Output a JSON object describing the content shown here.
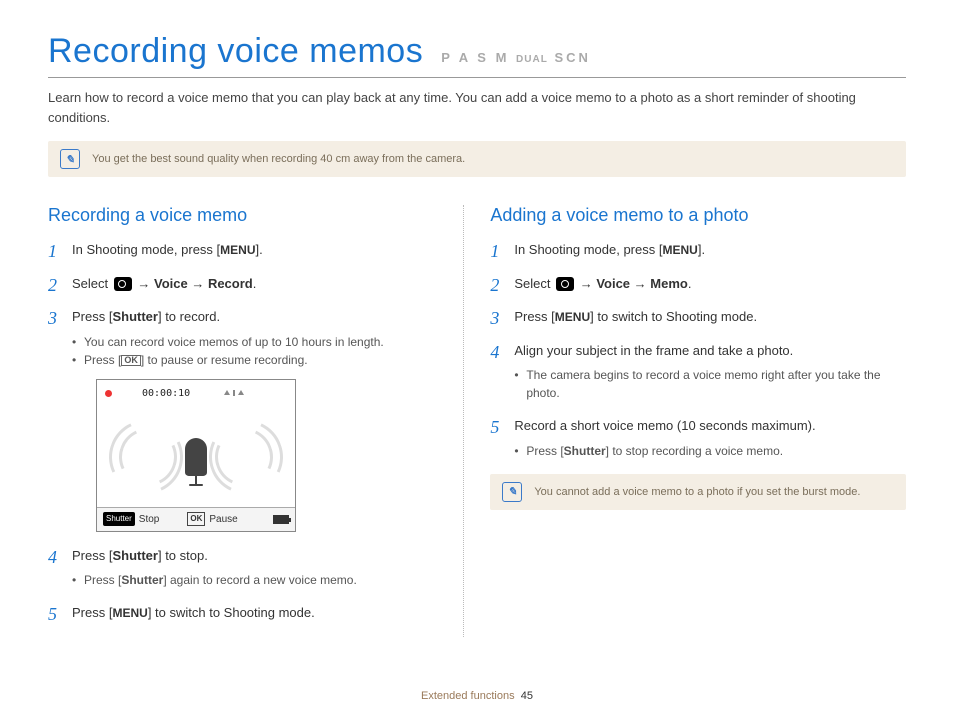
{
  "header": {
    "title": "Recording voice memos",
    "modes": "P A S M",
    "modes_small": "DUAL",
    "modes_end": "SCN"
  },
  "intro": "Learn how to record a voice memo that you can play back at any time. You can add a voice memo to a photo as a short reminder of shooting conditions.",
  "tip_top": "You get the best sound quality when recording 40 cm away from the camera.",
  "left": {
    "heading": "Recording a voice memo",
    "s1_a": "In Shooting mode, press [",
    "s1_menu": "MENU",
    "s1_b": "].",
    "s2_a": "Select ",
    "s2_b": " → ",
    "s2_voice": "Voice",
    "s2_c": " → ",
    "s2_record": "Record",
    "s2_d": ".",
    "s3_a": "Press [",
    "s3_shutter": "Shutter",
    "s3_b": "] to record.",
    "s3_sub1": "You can record voice memos of up to 10 hours in length.",
    "s3_sub2_a": "Press [",
    "s3_sub2_b": "] to pause or resume recording.",
    "s4_a": "Press [",
    "s4_shutter": "Shutter",
    "s4_b": "] to stop.",
    "s4_sub_a": "Press [",
    "s4_sub_shutter": "Shutter",
    "s4_sub_b": "] again to record a new voice memo.",
    "s5_a": "Press [",
    "s5_menu": "MENU",
    "s5_b": "] to switch to Shooting mode.",
    "mock": {
      "time": "00:00:10",
      "stop": "Stop",
      "pause": "Pause",
      "shutter": "Shutter",
      "ok": "OK"
    }
  },
  "right": {
    "heading": "Adding a voice memo to a photo",
    "s1_a": "In Shooting mode, press [",
    "s1_menu": "MENU",
    "s1_b": "].",
    "s2_a": "Select ",
    "s2_b": " → ",
    "s2_voice": "Voice",
    "s2_c": " → ",
    "s2_memo": "Memo",
    "s2_d": ".",
    "s3_a": "Press [",
    "s3_menu": "MENU",
    "s3_b": "] to switch to Shooting mode.",
    "s4": "Align your subject in the frame and take a photo.",
    "s4_sub": "The camera begins to record a voice memo right after you take the photo.",
    "s5": "Record a short voice memo (10 seconds maximum).",
    "s5_sub_a": "Press [",
    "s5_sub_shutter": "Shutter",
    "s5_sub_b": "] to stop recording a voice memo.",
    "tip": "You cannot add a voice memo to a photo if you set the burst mode."
  },
  "footer": {
    "section": "Extended functions",
    "page": "45"
  }
}
